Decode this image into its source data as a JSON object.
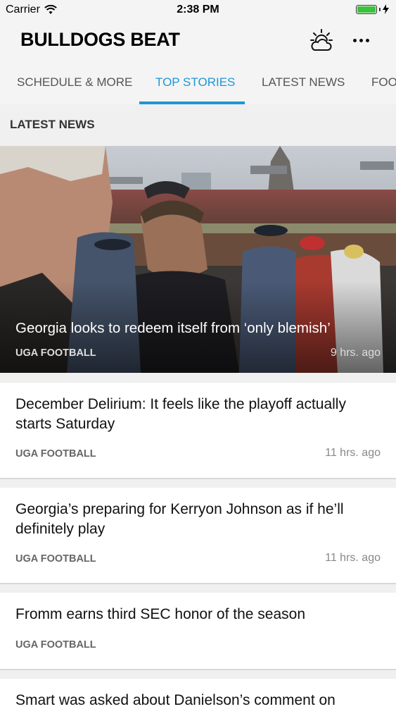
{
  "status_bar": {
    "carrier": "Carrier",
    "time": "2:38 PM"
  },
  "app": {
    "title": "BULLDOGS BEAT",
    "weather_icon": "weather-partly-cloudy-icon",
    "more_icon": "more-horizontal-icon"
  },
  "tabs": [
    {
      "label": "SCHEDULE & MORE",
      "active": false
    },
    {
      "label": "TOP STORIES",
      "active": true
    },
    {
      "label": "LATEST NEWS",
      "active": false
    },
    {
      "label": "FOO",
      "active": false
    }
  ],
  "section": {
    "title": "LATEST NEWS"
  },
  "colors": {
    "accent": "#1e96d6",
    "battery": "#3cc23c"
  },
  "hero": {
    "headline": "Georgia looks to redeem itself from ‘only blemish’",
    "category": "UGA FOOTBALL",
    "time": "9 hrs. ago"
  },
  "stories": [
    {
      "headline": "December Delirium: It feels like the playoff actually starts Saturday",
      "category": "UGA FOOTBALL",
      "time": "11 hrs. ago"
    },
    {
      "headline": "Georgia’s preparing for Kerryon Johnson as if he’ll definitely play",
      "category": "UGA FOOTBALL",
      "time": "11 hrs. ago"
    },
    {
      "headline": "Fromm earns third SEC honor of the season",
      "category": "UGA FOOTBALL",
      "time": ""
    },
    {
      "headline": "Smart was asked about Danielson’s comment on",
      "category": "",
      "time": ""
    }
  ]
}
